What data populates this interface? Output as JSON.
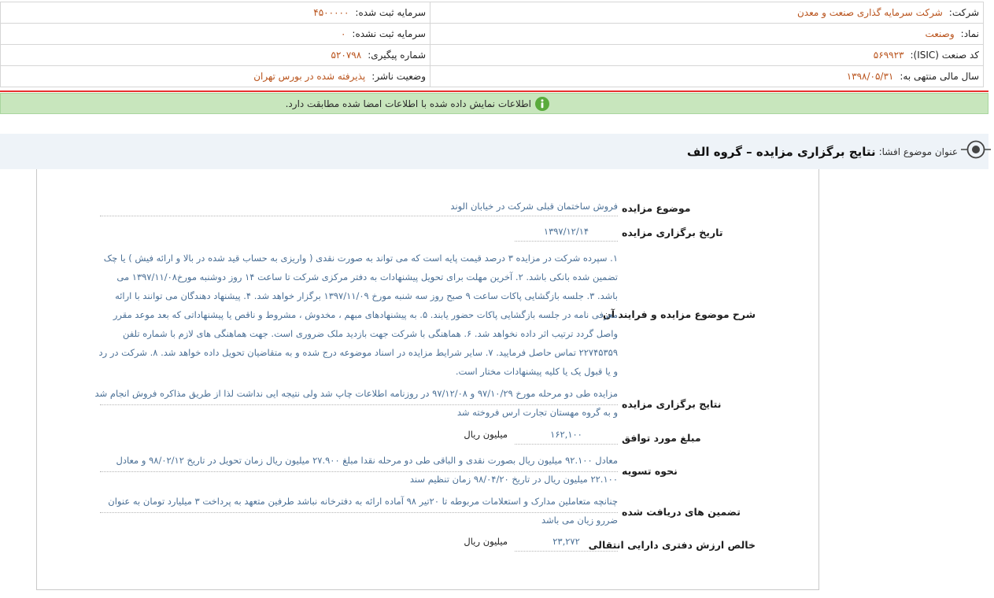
{
  "colors": {
    "header_value": "#b9531c",
    "detail_value": "#4a6f95",
    "verified_bg": "#c8e6bd",
    "alert_line": "#e8312f",
    "subject_bar_bg": "#eef3f8"
  },
  "header": {
    "rows": [
      {
        "right": {
          "label": "شرکت:",
          "value": "شرکت سرمایه گذاری صنعت و معدن"
        },
        "left": {
          "label": "سرمایه ثبت شده:",
          "value": "۴۵۰۰۰۰۰"
        }
      },
      {
        "right": {
          "label": "نماد:",
          "value": "وصنعت"
        },
        "left": {
          "label": "سرمایه ثبت نشده:",
          "value": "۰"
        }
      },
      {
        "right": {
          "label": "کد صنعت (ISIC):",
          "value": "۵۶۹۹۲۳"
        },
        "left": {
          "label": "شماره پیگیری:",
          "value": "۵۲۰۷۹۸"
        }
      },
      {
        "right": {
          "label": "سال مالی منتهی به:",
          "value": "۱۳۹۸/۰۵/۳۱"
        },
        "left": {
          "label": "وضعیت ناشر:",
          "value": "پذیرفته شده در بورس تهران"
        }
      }
    ]
  },
  "verification": {
    "icon": "info-icon",
    "message": "اطلاعات نمایش داده شده با اطلاعات امضا شده مطابقت دارد."
  },
  "subject": {
    "icon": "target-icon",
    "label": "عنوان موضوع افشا:",
    "title": "نتایج برگزاری مزایده – گروه الف"
  },
  "details": [
    {
      "label": "موضوع مزایده",
      "value": "فروش ساختمان قبلی شرکت در خیابان الوند"
    },
    {
      "label": "تاریخ برگزاری مزایده",
      "value": "۱۳۹۷/۱۲/۱۴"
    },
    {
      "label": "شرح موضوع مزایده و فرایند آن",
      "value": "۱. سپرده شرکت در مزایده ۳ درصد قیمت پایه است که می تواند به صورت نقدی ( واریزی به حساب قید شده در بالا و ارائه فیش ) یا چک تضمین شده بانکی باشد. ۲. آخرین مهلت برای تحویل پیشنهادات به دفتر مرکزی شرکت تا ساعت ۱۴ روز دوشنبه مورخ۱۳۹۷/۱۱/۰۸ می باشد. ۳. جلسه بازگشایی پاکات ساعت ۹ صبح روز سه شنبه مورخ ۱۳۹۷/۱۱/۰۹ برگزار خواهد شد. ۴. پیشنهاد دهندگان می توانند با ارائه معرفی نامه در جلسه بازگشایی پاکات حضور یابند. ۵. به پیشنهادهای مبهم ، مخدوش ، مشروط و ناقص یا پیشنهاداتی که بعد موعد مقرر واصل گردد ترتیب اثر داده نخواهد شد. ۶. هماهنگی با شرکت جهت بازدید ملک ضروری است. جهت هماهنگی های لازم با شماره تلفن ۲۲۷۴۵۳۵۹ تماس حاصل فرمایید. ۷. سایر شرایط مزایده در اسناد موضوعه درج شده و به متقاضیان تحویل داده خواهد شد. ۸. شرکت در رد و یا قبول یک یا کلیه پیشنهادات مختار است."
    },
    {
      "label": "نتایج برگزاری مزایده",
      "value": "مزایده طی دو مرحله مورخ ۹۷/۱۰/۲۹ و ۹۷/۱۲/۰۸ در روزنامه اطلاعات چاپ شد ولی نتیجه ایی نداشت لذا از طریق مذاکره فروش انجام شد و به گروه مهستان تجارت ارس فروخته شد"
    },
    {
      "label": "مبلغ مورد توافق",
      "value": "۱۶۲,۱۰۰",
      "unit": "میلیون ریال"
    },
    {
      "label": "نحوه تسویه",
      "value": "معادل ۹۲.۱۰۰ میلیون ریال بصورت نقدی و الباقی طی دو مرحله نقدا مبلغ ۲۷.۹۰۰ میلیون ریال زمان تحویل در تاریخ ۹۸/۰۲/۱۲ و معادل ۲۲.۱۰۰ میلیون ریال در تاریخ ۹۸/۰۴/۲۰ زمان تنظیم سند"
    },
    {
      "label": "تضمین های دریافت شده",
      "value": "چنانچه متعاملین مدارک و استعلامات مربوطه تا ۲۰تیر ۹۸ آماده ارائه به دفترخانه نباشد طرفین متعهد به پرداخت ۳ میلیارد تومان به عنوان ضررو زیان می باشد"
    },
    {
      "label": "خالص ارزش دفتری دارایی انتقالی",
      "value": "۲۳,۲۷۲",
      "unit": "میلیون ریال"
    }
  ]
}
